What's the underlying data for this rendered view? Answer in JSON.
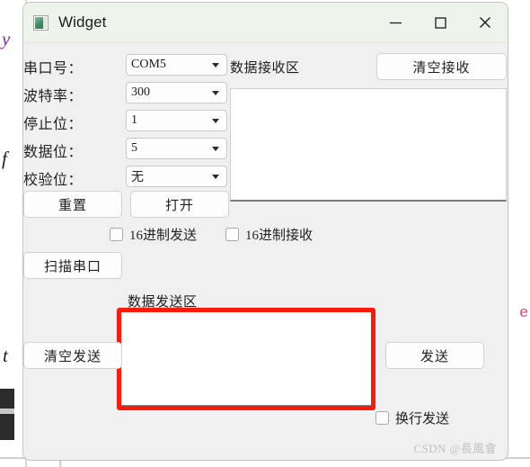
{
  "window": {
    "title": "Widget",
    "icon": "qt-app-icon",
    "controls": {
      "minimize": "minimize-icon",
      "maximize": "maximize-icon",
      "close": "close-icon"
    }
  },
  "settings": {
    "rows": [
      {
        "label": "串口号：",
        "value": "COM5"
      },
      {
        "label": "波特率：",
        "value": "300"
      },
      {
        "label": "停止位：",
        "value": "1"
      },
      {
        "label": "数据位：",
        "value": "5"
      },
      {
        "label": "校验位：",
        "value": "无"
      }
    ]
  },
  "buttons": {
    "reset": "重置",
    "open": "打开",
    "scan_port": "扫描串口",
    "clear_receive": "清空接收",
    "clear_send": "清空发送",
    "send": "发送"
  },
  "checkboxes": {
    "hex_send": "16进制发送",
    "hex_receive": "16进制接收",
    "newline_send": "换行发送"
  },
  "sections": {
    "receive_area_label": "数据接收区",
    "send_area_label": "数据发送区"
  },
  "text_areas": {
    "receive_value": "",
    "send_value": ""
  },
  "annotation": {
    "highlight_color": "#fb1b0c",
    "target": "send-textarea"
  },
  "watermark": "CSDN @長風會",
  "background": {
    "letters": [
      "y",
      "f",
      "t",
      "e"
    ]
  }
}
